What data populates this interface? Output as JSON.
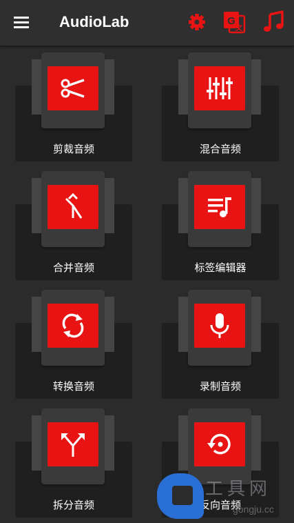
{
  "appbar": {
    "title": "AudioLab",
    "icons": [
      "menu-icon",
      "settings-gear-icon",
      "translate-icon",
      "music-note-icon"
    ],
    "accent_color": "#e81414"
  },
  "tools": [
    {
      "label": "剪裁音频",
      "icon": "scissors-icon"
    },
    {
      "label": "混合音频",
      "icon": "equalizer-sliders-icon"
    },
    {
      "label": "合并音频",
      "icon": "merge-arrows-icon"
    },
    {
      "label": "标签编辑器",
      "icon": "playlist-music-icon"
    },
    {
      "label": "转换音频",
      "icon": "refresh-cycle-icon"
    },
    {
      "label": "录制音频",
      "icon": "microphone-icon"
    },
    {
      "label": "拆分音频",
      "icon": "split-arrows-icon"
    },
    {
      "label": "反向音频",
      "icon": "reverse-restore-icon"
    }
  ],
  "watermark": {
    "text": "工具网",
    "sub": "gongju.cc"
  }
}
